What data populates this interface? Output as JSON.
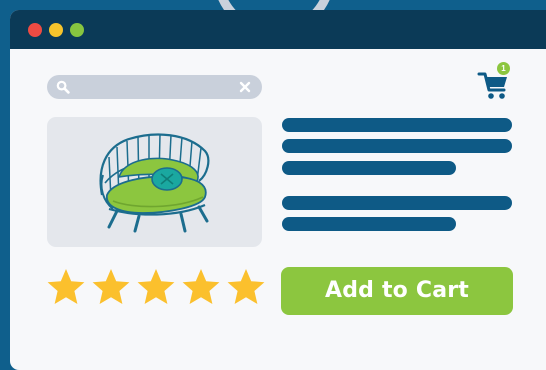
{
  "window": {
    "controls": [
      "close",
      "minimize",
      "maximize"
    ]
  },
  "search": {
    "icon": "search-icon",
    "clear_icon": "close-icon"
  },
  "cart": {
    "icon": "shopping-cart-icon",
    "badge_count": "1"
  },
  "product": {
    "image_icon": "armchair-illustration",
    "rating_stars": 5,
    "rating_max": 5,
    "add_to_cart_label": "Add to Cart"
  },
  "colors": {
    "background": "#0f5f8c",
    "title_bar": "#0b3a57",
    "window": "#f7f8fa",
    "accent_green": "#8cc63f",
    "text_placeholder": "#0e5a86",
    "star": "#fbc02d",
    "search_bar": "#c9d0db",
    "image_bg": "#e4e7ec"
  }
}
